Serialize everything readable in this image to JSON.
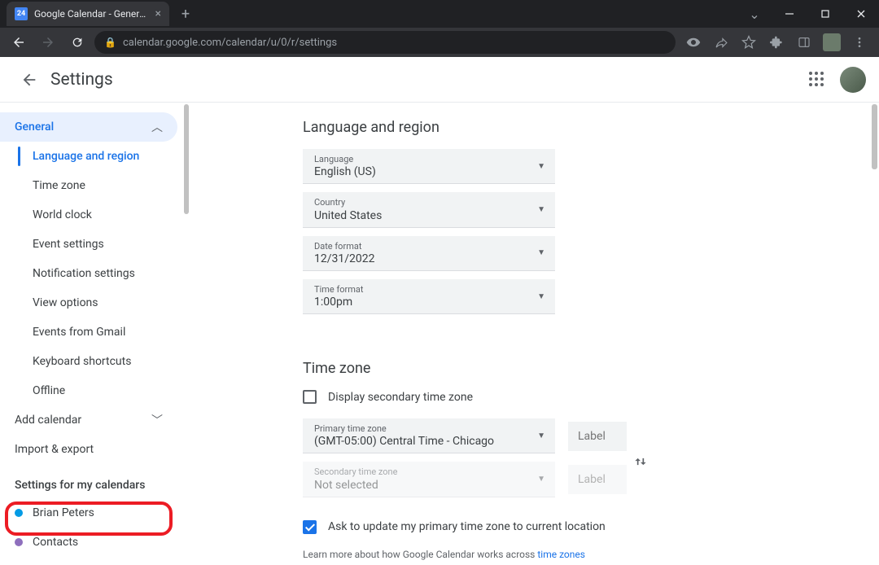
{
  "browser": {
    "tab_title": "Google Calendar - General settin",
    "url": "calendar.google.com/calendar/u/0/r/settings"
  },
  "header": {
    "title": "Settings"
  },
  "sidebar": {
    "general_label": "General",
    "general_subs": [
      "Language and region",
      "Time zone",
      "World clock",
      "Event settings",
      "Notification settings",
      "View options",
      "Events from Gmail",
      "Keyboard shortcuts",
      "Offline"
    ],
    "add_calendar": "Add calendar",
    "import_export": "Import & export",
    "my_calendars_heading": "Settings for my calendars",
    "calendars": [
      {
        "name": "Brian Peters",
        "color": "#039be5"
      },
      {
        "name": "Contacts",
        "color": "#8e6fbd"
      }
    ]
  },
  "content": {
    "lang_region": {
      "title": "Language and region",
      "fields": [
        {
          "label": "Language",
          "value": "English (US)"
        },
        {
          "label": "Country",
          "value": "United States"
        },
        {
          "label": "Date format",
          "value": "12/31/2022"
        },
        {
          "label": "Time format",
          "value": "1:00pm"
        }
      ]
    },
    "timezone": {
      "title": "Time zone",
      "secondary_checkbox": "Display secondary time zone",
      "primary_label": "Primary time zone",
      "primary_value": "(GMT-05:00) Central Time - Chicago",
      "secondary_label": "Secondary time zone",
      "secondary_value": "Not selected",
      "label_placeholder": "Label",
      "ask_update": "Ask to update my primary time zone to current location",
      "learn_prefix": "Learn more about how Google Calendar works across ",
      "learn_link": "time zones"
    }
  }
}
